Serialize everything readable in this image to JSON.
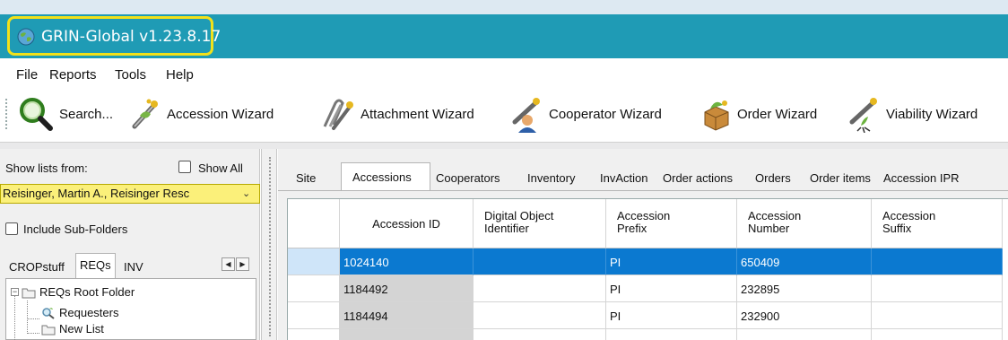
{
  "window": {
    "title": "GRIN-Global v1.23.8.17",
    "highlight_color": "#f2e11a",
    "titlebar_color": "#1f9bb5"
  },
  "menu": {
    "items": [
      "File",
      "Reports",
      "Tools",
      "Help"
    ]
  },
  "toolbar": {
    "items": [
      {
        "label": "Search...",
        "icon": "search-icon"
      },
      {
        "label": "Accession Wizard",
        "icon": "accession-wizard-icon"
      },
      {
        "label": "Attachment Wizard",
        "icon": "attachment-wizard-icon"
      },
      {
        "label": "Cooperator Wizard",
        "icon": "cooperator-wizard-icon"
      },
      {
        "label": "Order Wizard",
        "icon": "order-wizard-icon"
      },
      {
        "label": "Viability Wizard",
        "icon": "viability-wizard-icon"
      }
    ]
  },
  "left_panel": {
    "show_lists_label": "Show lists from:",
    "show_all_label": "Show All",
    "show_all_checked": false,
    "owner_combo_value": "Reisinger, Martin A., Reisinger Resc",
    "owner_combo_color": "#fbf07a",
    "include_subfolders_label": "Include Sub-Folders",
    "include_subfolders_checked": false,
    "tabs": [
      "CROPstuff",
      "REQs",
      "INV"
    ],
    "active_tab": "REQs",
    "tree": {
      "root": "REQs Root Folder",
      "children": [
        "Requesters",
        "New List"
      ]
    }
  },
  "right_panel": {
    "tabs": [
      "Site",
      "Accessions",
      "Cooperators",
      "Inventory",
      "InvAction",
      "Order actions",
      "Orders",
      "Order items",
      "Accession IPR"
    ],
    "active_tab": "Accessions",
    "grid": {
      "columns": [
        "Accession ID",
        "Digital Object Identifier",
        "Accession Prefix",
        "Accession Number",
        "Accession Suffix"
      ],
      "rows": [
        {
          "accession_id": "1024140",
          "doi": "",
          "prefix": "PI",
          "number": "650409",
          "suffix": "",
          "selected": true
        },
        {
          "accession_id": "1184492",
          "doi": "",
          "prefix": "PI",
          "number": "232895",
          "suffix": "",
          "selected": false
        },
        {
          "accession_id": "1184494",
          "doi": "",
          "prefix": "PI",
          "number": "232900",
          "suffix": "",
          "selected": false
        }
      ],
      "selection_color": "#0b79d0"
    }
  }
}
